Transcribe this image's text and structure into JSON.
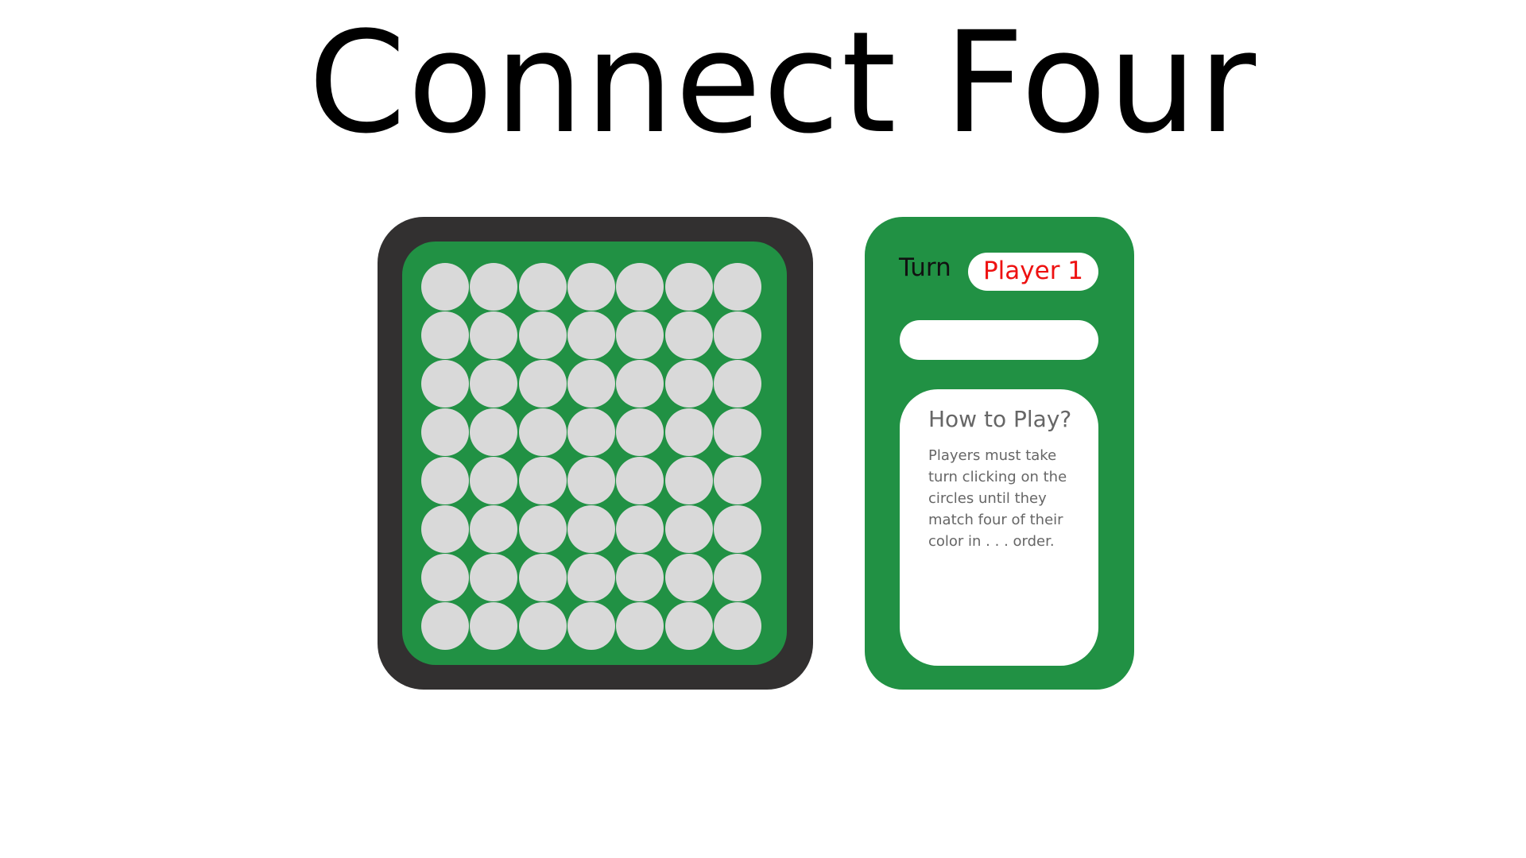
{
  "title": "Connect Four",
  "board": {
    "rows": 8,
    "columns": 7,
    "empty_color": "#d9d9d9",
    "frame_color": "#323030",
    "board_color": "#219144"
  },
  "status": {
    "turn_label": "Turn",
    "current_player": "Player 1",
    "current_player_color": "#ee1111",
    "message": ""
  },
  "help": {
    "title": "How to Play?",
    "text": "Players must take turn clicking on the circles until they match four of their color in . . . order."
  }
}
